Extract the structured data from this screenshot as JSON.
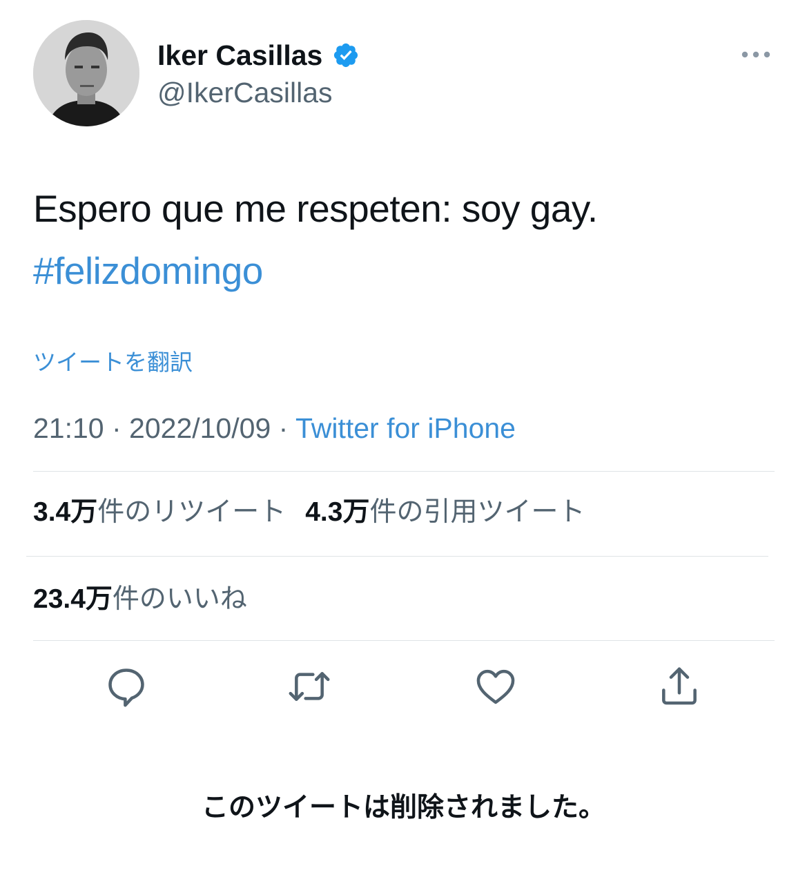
{
  "user": {
    "display_name": "Iker Casillas",
    "handle": "@IkerCasillas",
    "verified_icon": "verified-badge-icon"
  },
  "tweet": {
    "text": "Espero que me respeten: soy gay.",
    "hashtag": "#felizdomingo",
    "translate_label": "ツイートを翻訳",
    "time": "21:10",
    "separator": " · ",
    "date": "2022/10/09",
    "source": "Twitter for iPhone"
  },
  "stats": {
    "retweets_count": "3.4万",
    "retweets_label": "件のリツイート",
    "quotes_count": "4.3万",
    "quotes_label": "件の引用ツイート",
    "likes_count": "23.4万",
    "likes_label": "件のいいね"
  },
  "actions": [
    "reply-icon",
    "retweet-icon",
    "like-icon",
    "share-icon"
  ],
  "notice": "このツイートは削除されました。",
  "colors": {
    "link": "#3b8fd6",
    "secondary_text": "#536471",
    "divider": "#dfe3e6",
    "verified": "#1d9bf0"
  }
}
